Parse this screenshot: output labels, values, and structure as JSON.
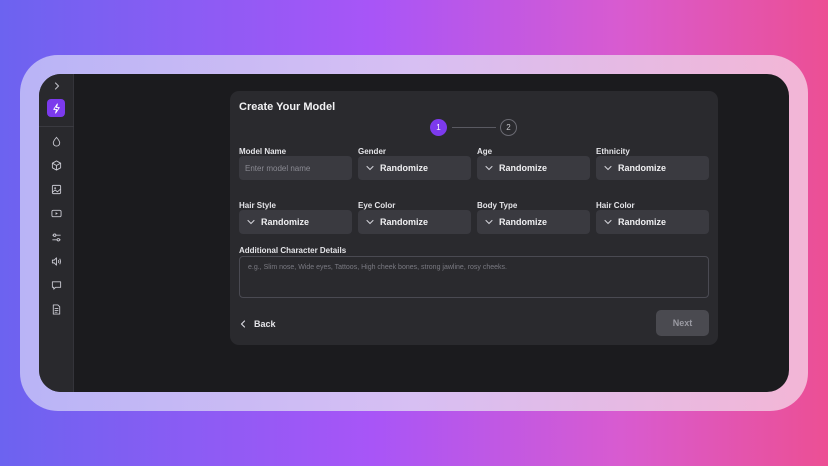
{
  "form": {
    "title": "Create Your Model",
    "steps": [
      "1",
      "2"
    ],
    "model_name": {
      "label": "Model Name",
      "placeholder": "Enter model name"
    },
    "selects": [
      {
        "label": "Gender",
        "value": "Randomize"
      },
      {
        "label": "Age",
        "value": "Randomize"
      },
      {
        "label": "Ethnicity",
        "value": "Randomize"
      },
      {
        "label": "Hair Style",
        "value": "Randomize"
      },
      {
        "label": "Eye Color",
        "value": "Randomize"
      },
      {
        "label": "Body Type",
        "value": "Randomize"
      },
      {
        "label": "Hair Color",
        "value": "Randomize"
      }
    ],
    "details": {
      "label": "Additional Character Details",
      "placeholder": "e.g., Slim nose, Wide eyes, Tattoos, High cheek bones, strong jawline, rosy cheeks."
    },
    "back_label": "Back",
    "next_label": "Next"
  },
  "sidebar": {
    "icons": [
      "collapse-chevron-icon",
      "bolt-logo-icon",
      "droplet-icon",
      "cube-icon",
      "image-icon",
      "video-icon",
      "sliders-icon",
      "speaker-icon",
      "chat-icon",
      "document-icon"
    ]
  },
  "colors": {
    "accent": "#7c3aed",
    "card": "#2a2a2e",
    "field": "#3a3a40",
    "window": "#1b1b1e"
  }
}
